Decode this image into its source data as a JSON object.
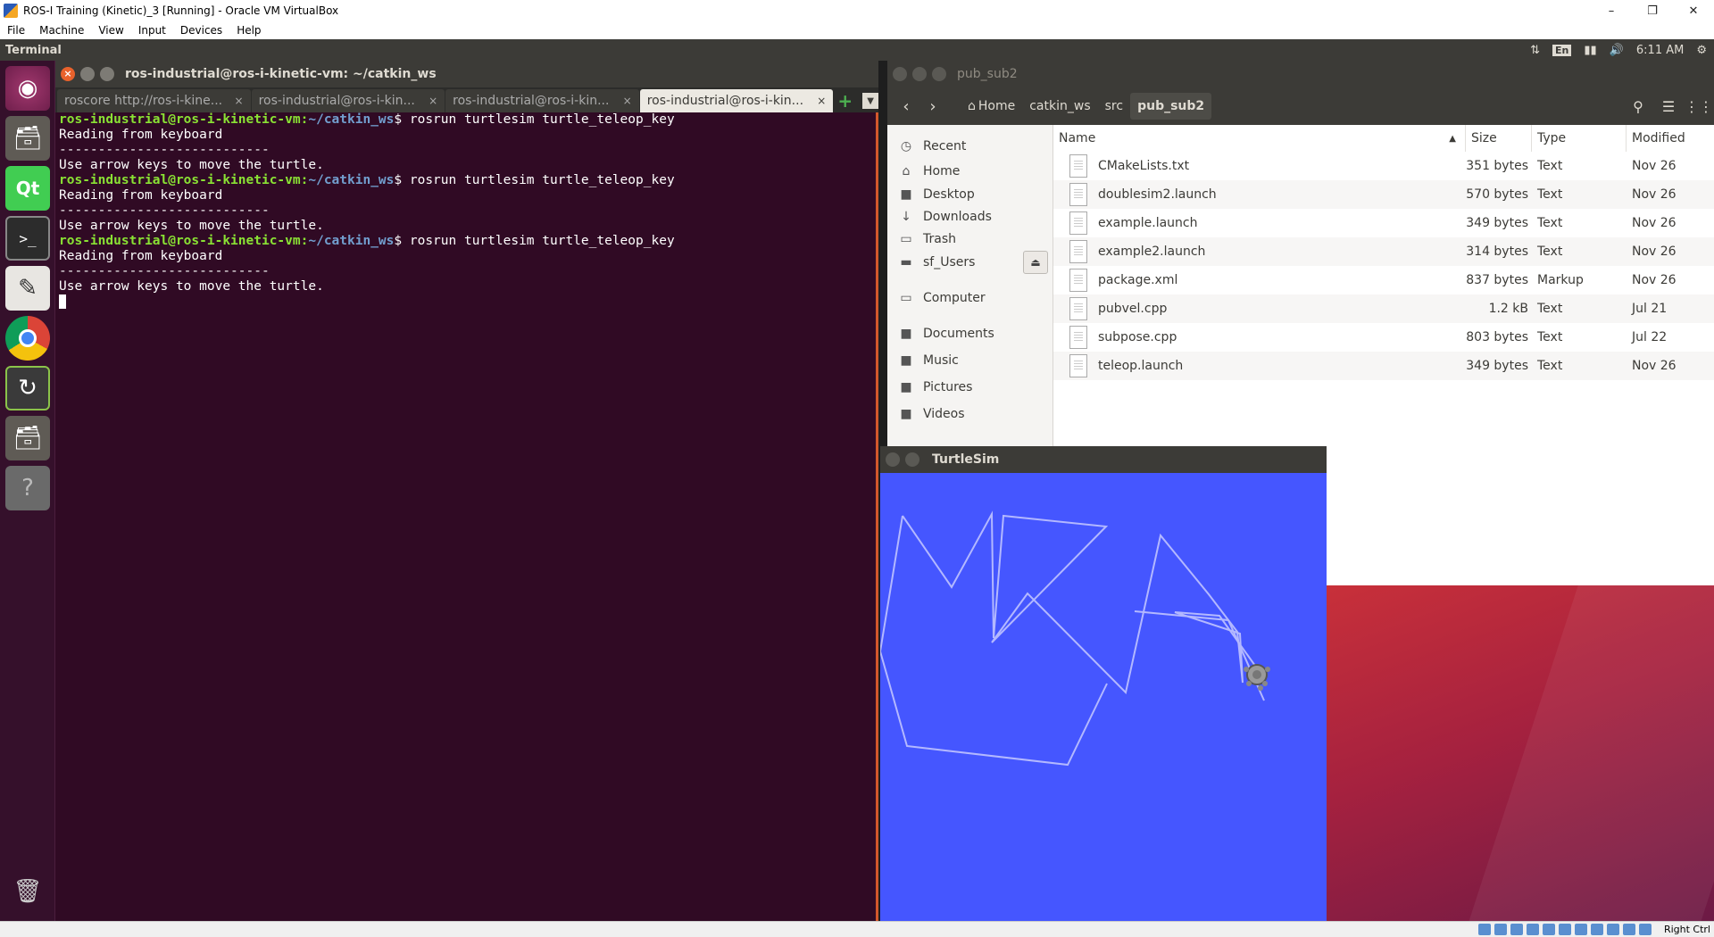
{
  "host": {
    "title": "ROS-I Training (Kinetic)_3 [Running] - Oracle VM VirtualBox",
    "menu": [
      "File",
      "Machine",
      "View",
      "Input",
      "Devices",
      "Help"
    ],
    "host_key": "Right Ctrl"
  },
  "panel": {
    "app_title": "Terminal",
    "keyboard_layout": "En",
    "time": "6:11 AM"
  },
  "launcher": {
    "items": [
      "ubuntu-dash",
      "files",
      "qt-creator",
      "terminal",
      "text-editor",
      "chrome",
      "software-updater",
      "files-2",
      "help"
    ],
    "trash": "trash"
  },
  "terminal": {
    "title": "ros-industrial@ros-i-kinetic-vm: ~/catkin_ws",
    "tabs": [
      {
        "label": "roscore http://ros-i-kine..."
      },
      {
        "label": "ros-industrial@ros-i-kin..."
      },
      {
        "label": "ros-industrial@ros-i-kin..."
      },
      {
        "label": "ros-industrial@ros-i-kin..."
      }
    ],
    "prompt_user": "ros-industrial@ros-i-kinetic-vm",
    "prompt_path": "~/catkin_ws",
    "command": "rosrun turtlesim turtle_teleop_key",
    "out_reading": "Reading from keyboard",
    "out_dashes": "---------------------------",
    "out_use": "Use arrow keys to move the turtle."
  },
  "files": {
    "title": "pub_sub2",
    "breadcrumbs": [
      "Home",
      "catkin_ws",
      "src",
      "pub_sub2"
    ],
    "sidebar": [
      "Recent",
      "Home",
      "Desktop",
      "Downloads",
      "Trash",
      "sf_Users",
      "Computer",
      "Documents",
      "Music",
      "Pictures",
      "Videos"
    ],
    "columns": {
      "name": "Name",
      "size": "Size",
      "type": "Type",
      "modified": "Modified"
    },
    "rows": [
      {
        "name": "CMakeLists.txt",
        "size": "351 bytes",
        "type": "Text",
        "modified": "Nov 26"
      },
      {
        "name": "doublesim2.launch",
        "size": "570 bytes",
        "type": "Text",
        "modified": "Nov 26"
      },
      {
        "name": "example.launch",
        "size": "349 bytes",
        "type": "Text",
        "modified": "Nov 26"
      },
      {
        "name": "example2.launch",
        "size": "314 bytes",
        "type": "Text",
        "modified": "Nov 26"
      },
      {
        "name": "package.xml",
        "size": "837 bytes",
        "type": "Markup",
        "modified": "Nov 26"
      },
      {
        "name": "pubvel.cpp",
        "size": "1.2 kB",
        "type": "Text",
        "modified": "Jul 21"
      },
      {
        "name": "subpose.cpp",
        "size": "803 bytes",
        "type": "Text",
        "modified": "Jul 22"
      },
      {
        "name": "teleop.launch",
        "size": "349 bytes",
        "type": "Text",
        "modified": "Nov 26"
      }
    ]
  },
  "turtlesim": {
    "title": "TurtleSim",
    "background": "#4556ff",
    "pen_color": "#b3b8ff"
  }
}
